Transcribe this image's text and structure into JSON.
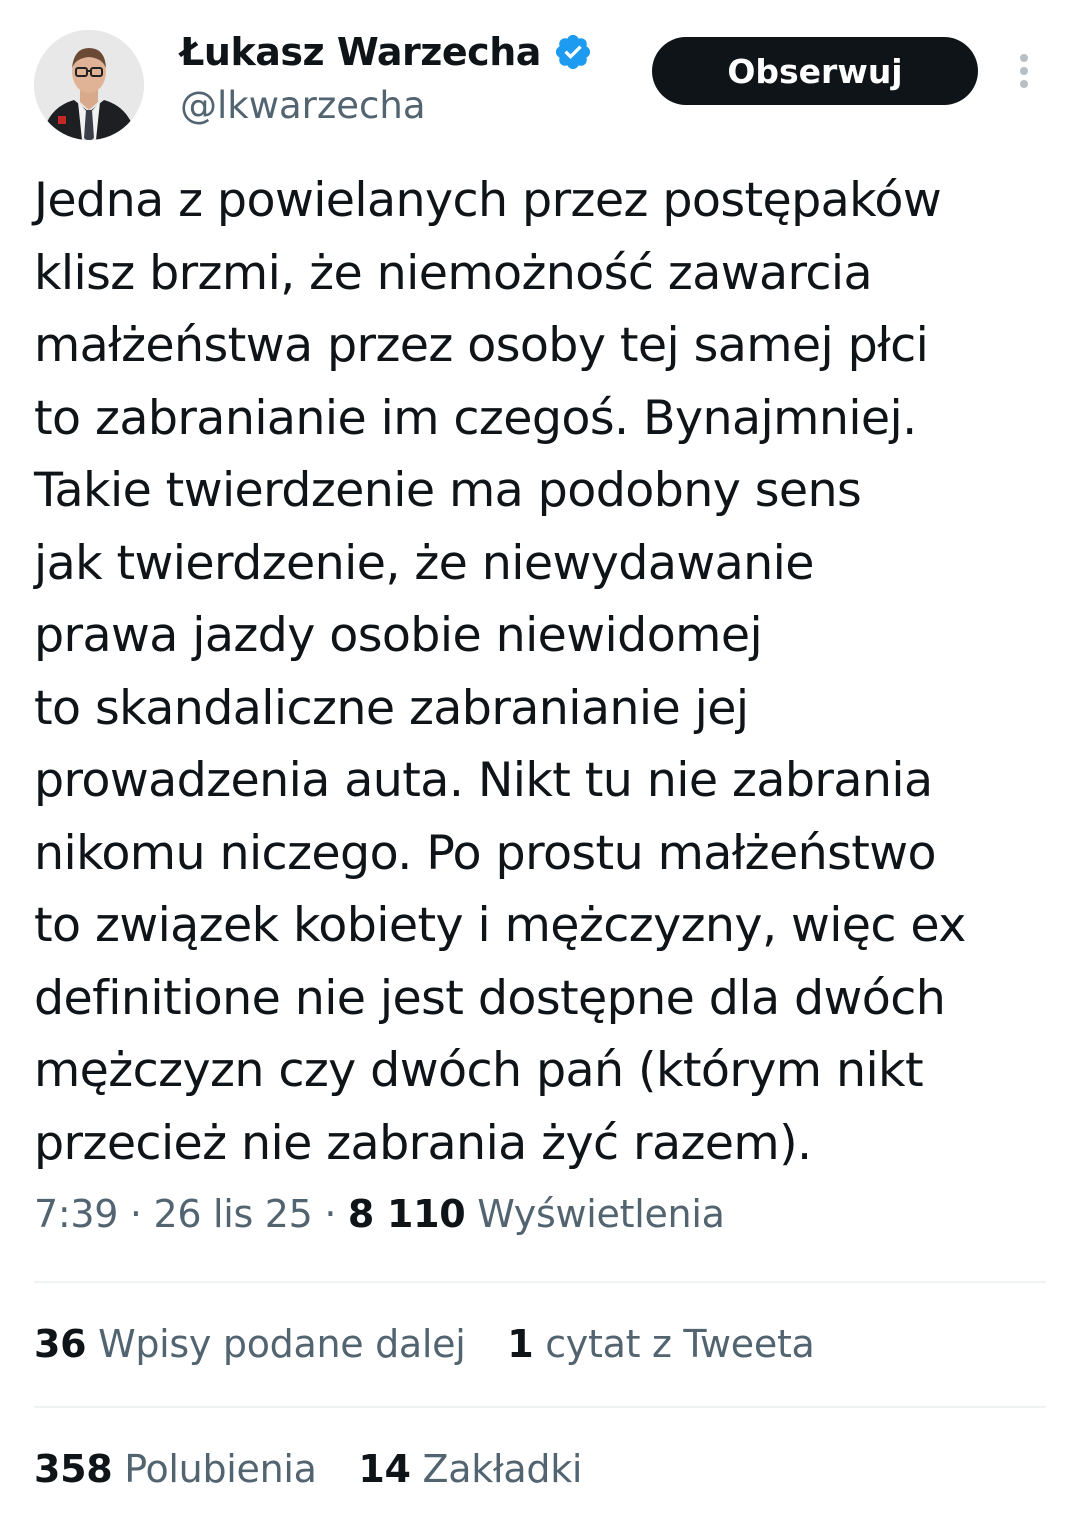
{
  "author": {
    "display_name": "Łukasz Warzecha",
    "handle": "@lkwarzecha",
    "verified": true,
    "verified_color": "#1d9bf0"
  },
  "actions": {
    "follow_label": "Obserwuj"
  },
  "tweet": {
    "lines": [
      "Jedna z powielanych przez postępaków",
      "klisz brzmi, że niemożność zawarcia",
      "małżeństwa przez osoby tej samej płci",
      "to zabranianie im czegoś. Bynajmniej.",
      "Takie twierdzenie ma podobny sens",
      "jak twierdzenie, że niewydawanie",
      "prawa jazdy osobie niewidomej",
      "to skandaliczne zabranianie jej",
      "prowadzenia auta. Nikt tu nie zabrania",
      "nikomu niczego. Po prostu małżeństwo",
      "to związek kobiety i mężczyzny, więc ex",
      "definitione nie jest dostępne dla dwóch",
      "mężczyzn czy dwóch pań (którym nikt",
      "przecież nie zabrania żyć razem)."
    ]
  },
  "meta": {
    "time": "7:39",
    "separator": " · ",
    "date": "26 lis 25",
    "views_count": "8 110",
    "views_label": "Wyświetlenia"
  },
  "stats": {
    "retweets_count": "36",
    "retweets_label": "Wpisy podane dalej",
    "quotes_count": "1",
    "quotes_label": "cytat z Tweeta",
    "likes_count": "358",
    "likes_label": "Polubienia",
    "bookmarks_count": "14",
    "bookmarks_label": "Zakładki"
  },
  "icons": {
    "avatar": "avatar-photo",
    "verified": "verified-badge-icon",
    "more": "more-vertical-icon"
  },
  "colors": {
    "text_primary": "#0f1419",
    "text_secondary": "#536471",
    "divider": "#eff3f4",
    "follow_button_bg": "#0f1419",
    "follow_button_text": "#ffffff"
  }
}
